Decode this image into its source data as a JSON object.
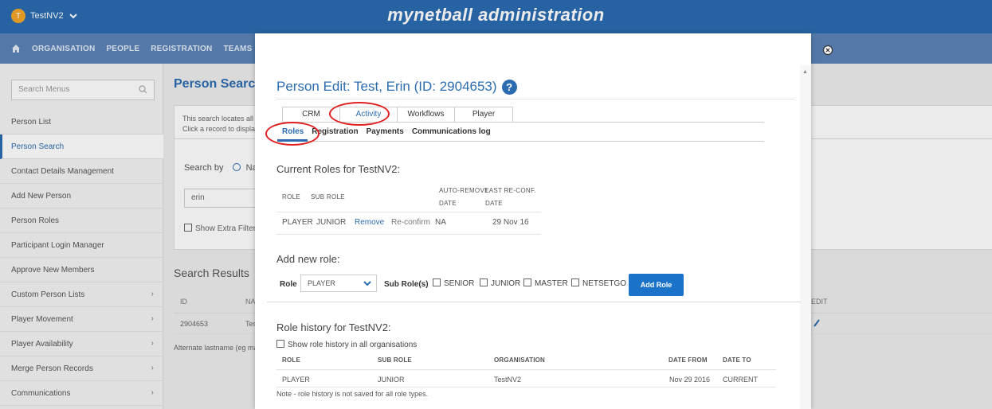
{
  "header": {
    "org_initial": "T",
    "org_name": "TestNV2",
    "app_title": "mynetball administration"
  },
  "nav": {
    "items": [
      "ORGANISATION",
      "PEOPLE",
      "REGISTRATION",
      "TEAMS"
    ]
  },
  "sidebar": {
    "search_placeholder": "Search Menus",
    "items": [
      {
        "label": "Person List"
      },
      {
        "label": "Person Search",
        "active": true
      },
      {
        "label": "Contact Details Management"
      },
      {
        "label": "Add New Person"
      },
      {
        "label": "Person Roles"
      },
      {
        "label": "Participant Login Manager"
      },
      {
        "label": "Approve New Members"
      },
      {
        "label": "Custom Person Lists",
        "submenu": true
      },
      {
        "label": "Player Movement",
        "submenu": true
      },
      {
        "label": "Player Availability",
        "submenu": true
      },
      {
        "label": "Merge Person Records",
        "submenu": true
      },
      {
        "label": "Communications",
        "submenu": true
      }
    ]
  },
  "background": {
    "title": "Person Search",
    "info_line1": "This search locates all",
    "info_line2": "Click a record to displa",
    "search_by": "Search by",
    "radio_label": "Nam",
    "input_value": "erin",
    "extra_filter": "Show Extra Filterin",
    "results_title": "Search Results",
    "col_id": "ID",
    "col_name": "NAI",
    "col_edit": "EDIT",
    "row_id": "2904653",
    "row_name": "Test",
    "note": "Alternate lastname (eg ma"
  },
  "modal": {
    "title": "Person Edit: Test, Erin (ID: 2904653)",
    "help_glyph": "?",
    "tabs": [
      "CRM",
      "Activity",
      "Workflows",
      "Player"
    ],
    "active_tab": "Activity",
    "subtabs": [
      "Roles",
      "Registration",
      "Payments",
      "Communications log"
    ],
    "active_subtab": "Roles",
    "current_roles": {
      "title": "Current Roles for TestNV2:",
      "headers": {
        "role": "ROLE",
        "sub_role": "SUB ROLE",
        "auto_remove_1": "AUTO-REMOVE",
        "auto_remove_2": "DATE",
        "last_reconf_1": "LAST RE-CONF.",
        "last_reconf_2": "DATE"
      },
      "row": {
        "role": "PLAYER",
        "sub_role": "JUNIOR",
        "remove": "Remove",
        "reconfirm": "Re-confirm",
        "auto_remove": "NA",
        "last_reconf": "29 Nov 16"
      }
    },
    "add_role": {
      "title": "Add new role:",
      "role_label": "Role",
      "role_value": "PLAYER",
      "sub_roles_label": "Sub Role(s)",
      "sub_roles": [
        "SENIOR",
        "JUNIOR",
        "MASTER",
        "NETSETGO"
      ],
      "button": "Add Role"
    },
    "role_history": {
      "title": "Role history for TestNV2:",
      "show_all": "Show role history in all organisations",
      "headers": [
        "ROLE",
        "SUB ROLE",
        "ORGANISATION",
        "DATE FROM",
        "DATE TO"
      ],
      "row": [
        "PLAYER",
        "JUNIOR",
        "TestNV2",
        "Nov 29 2016",
        "CURRENT"
      ],
      "note": "Note - role history is not saved for all role types."
    }
  },
  "colors": {
    "brand_blue": "#2b6cb0",
    "nav_blue": "#5c84b8",
    "button_blue": "#1a73c8",
    "annotation_red": "#e02020"
  }
}
